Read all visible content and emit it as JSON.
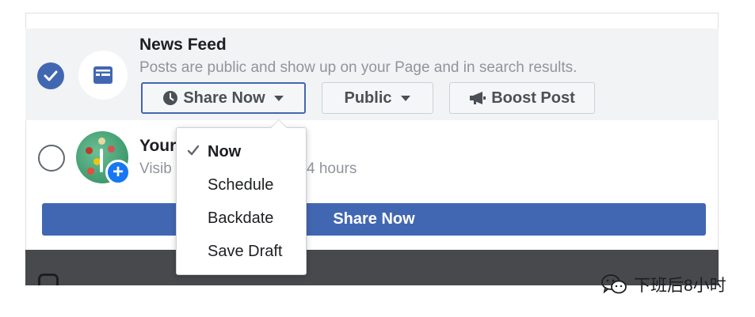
{
  "news_feed": {
    "title": "News Feed",
    "description": "Posts are public and show up on your Page and in search results.",
    "checked": true
  },
  "buttons": {
    "share_now": "Share Now",
    "public": "Public",
    "boost_post": "Boost Post"
  },
  "story": {
    "title_visible": "Your",
    "subtitle_visible": "Visib",
    "subtitle_tail": "4 hours",
    "checked": false
  },
  "dropdown": {
    "items": [
      {
        "label": "Now",
        "selected": true
      },
      {
        "label": "Schedule",
        "selected": false
      },
      {
        "label": "Backdate",
        "selected": false
      },
      {
        "label": "Save Draft",
        "selected": false
      }
    ]
  },
  "share_bar": {
    "label": "Share Now"
  },
  "watermark": {
    "text": "下班后8小时"
  },
  "colors": {
    "accent": "#4267b2",
    "row_highlight": "#f2f3f5",
    "muted_text": "#90949c",
    "badge_blue": "#1877f2",
    "dark_strip": "#47494c"
  },
  "icons": {
    "check": "checkmark-icon",
    "feed": "news-feed-icon",
    "clock": "clock-icon",
    "caret": "caret-down-icon",
    "megaphone": "megaphone-icon",
    "plus": "plus-icon",
    "instagram": "instagram-icon",
    "wechat": "wechat-icon"
  }
}
